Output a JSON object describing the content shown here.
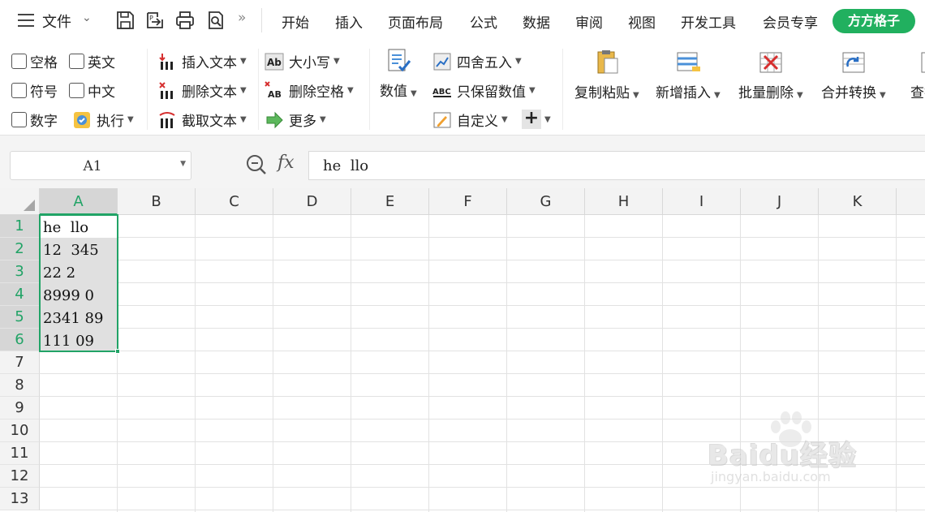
{
  "menubar": {
    "file_label": "文件",
    "tabs": [
      "开始",
      "插入",
      "页面布局",
      "公式",
      "数据",
      "审阅",
      "视图",
      "开发工具",
      "会员专享"
    ],
    "highlight_tab": "方方格子",
    "accent_color": "#21b05f"
  },
  "ribbon": {
    "checkboxes": [
      "空格",
      "英文",
      "符号",
      "中文",
      "数字"
    ],
    "execute": "执行",
    "text_ops": [
      "插入文本",
      "删除文本",
      "截取文本"
    ],
    "case_ops": [
      "大小写",
      "删除空格",
      "更多"
    ],
    "value_btn": "数值",
    "round_ops": [
      "四舍五入",
      "只保留数值",
      "自定义"
    ],
    "big_buttons": [
      "复制粘贴",
      "新增插入",
      "批量删除",
      "合并转换",
      "查找"
    ]
  },
  "formula_bar": {
    "name_box": "A1",
    "fx_label": "fx",
    "formula": "he  llo"
  },
  "grid": {
    "columns": [
      "A",
      "B",
      "C",
      "D",
      "E",
      "F",
      "G",
      "H",
      "I",
      "J",
      "K"
    ],
    "rows": [
      "1",
      "2",
      "3",
      "4",
      "5",
      "6",
      "7",
      "8",
      "9",
      "10",
      "11",
      "12",
      "13"
    ],
    "column_a": [
      "he  llo",
      "12  345",
      "22 2",
      "8999 0",
      "2341 89",
      "111 09"
    ],
    "selection_color": "#21a366"
  },
  "watermark": {
    "brand": "Baidu经验",
    "url": "jingyan.baidu.com"
  }
}
